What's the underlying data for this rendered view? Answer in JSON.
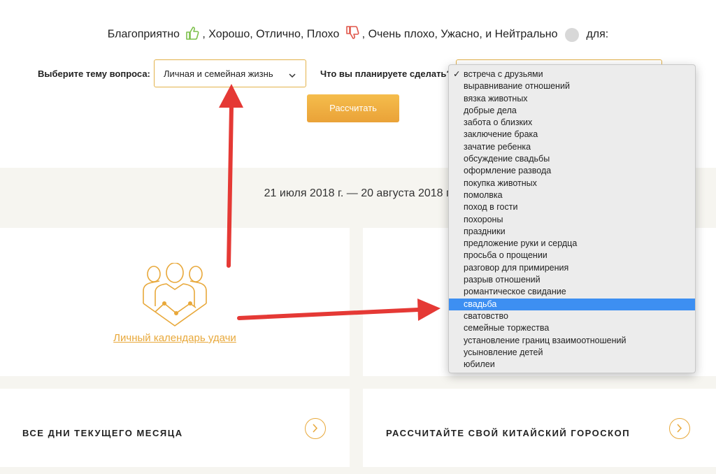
{
  "legend": {
    "favorable": "Благоприятно",
    "rest_positive": ", Хорошо, Отлично, Плохо",
    "rest_negative": ", Очень плохо, Ужасно, и Нейтрально",
    "suffix": "для:",
    "icons": [
      "thumbs-up-icon",
      "thumbs-down-icon",
      "neutral-circle-icon"
    ],
    "colors": {
      "positive": "#7cc04b",
      "negative": "#e0564a",
      "neutral": "#d8d8d8"
    }
  },
  "form": {
    "topic_label": "Выберите тему вопроса:",
    "topic_value": "Личная и семейная жизнь",
    "plan_label": "Что вы планируете сделать?",
    "calc_button": "Рассчитать"
  },
  "date_range": "21 июля 2018 г. — 20 августа 2018 г.",
  "cards": {
    "personal_calendar": "Личный календарь удачи",
    "month_days": "ВСЕ ДНИ ТЕКУЩЕГО МЕСЯЦА",
    "chinese_horoscope": "РАССЧИТАЙТЕ СВОЙ КИТАЙСКИЙ ГОРОСКОП"
  },
  "dropdown": {
    "checked_index": 0,
    "selected_index": 19,
    "options": [
      "встреча с друзьями",
      "выравнивание отношений",
      "вязка животных",
      "добрые дела",
      "забота о близких",
      "заключение брака",
      "зачатие ребенка",
      "обсуждение свадьбы",
      "оформление развода",
      "покупка животных",
      "помолвка",
      "поход в гости",
      "похороны",
      "праздники",
      "предложение руки и сердца",
      "просьба о прощении",
      "разговор для примирения",
      "разрыв отношений",
      "романтическое свидание",
      "свадьба",
      "сватовство",
      "семейные торжества",
      "установление границ взаимоотношений",
      "усыновление детей",
      "юбилеи"
    ]
  },
  "colors": {
    "accent": "#e8a83a",
    "arrow": "#e53935",
    "highlight": "#3d8ff2"
  }
}
